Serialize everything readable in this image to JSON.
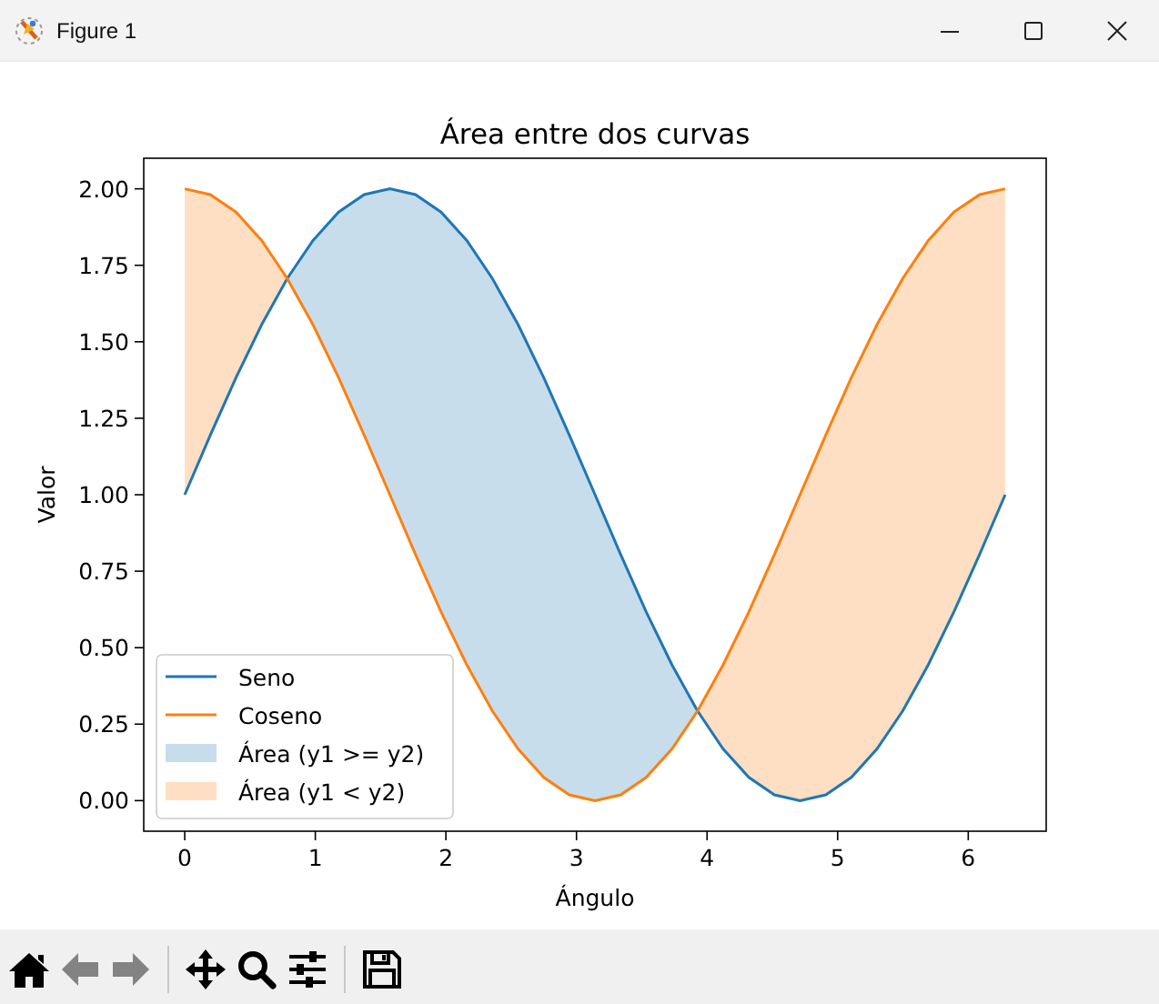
{
  "window": {
    "title": "Figure 1"
  },
  "figure": {
    "chart_data": {
      "type": "line",
      "title": "Área entre dos curvas",
      "xlabel": "Ángulo",
      "ylabel": "Valor",
      "x": [
        0,
        0.196,
        0.393,
        0.589,
        0.785,
        0.982,
        1.178,
        1.374,
        1.571,
        1.767,
        1.963,
        2.16,
        2.356,
        2.553,
        2.749,
        2.945,
        3.142,
        3.338,
        3.534,
        3.731,
        3.927,
        4.123,
        4.32,
        4.516,
        4.712,
        4.909,
        5.105,
        5.301,
        5.498,
        5.694,
        5.89,
        6.087,
        6.283
      ],
      "series": [
        {
          "name": "Seno",
          "type": "line",
          "color": "#1f77b4",
          "values": [
            1,
            1.195,
            1.383,
            1.556,
            1.707,
            1.831,
            1.924,
            1.981,
            2,
            1.981,
            1.924,
            1.831,
            1.707,
            1.556,
            1.383,
            1.195,
            1,
            0.805,
            0.617,
            0.444,
            0.293,
            0.169,
            0.076,
            0.019,
            0,
            0.019,
            0.076,
            0.169,
            0.293,
            0.444,
            0.617,
            0.805,
            1
          ]
        },
        {
          "name": "Coseno",
          "type": "line",
          "color": "#ff7f0e",
          "values": [
            2,
            1.981,
            1.924,
            1.831,
            1.707,
            1.556,
            1.383,
            1.195,
            1,
            0.805,
            0.617,
            0.444,
            0.293,
            0.169,
            0.076,
            0.019,
            0,
            0.019,
            0.076,
            0.169,
            0.293,
            0.444,
            0.617,
            0.805,
            1,
            1.195,
            1.383,
            1.556,
            1.707,
            1.831,
            1.924,
            1.981,
            2
          ]
        },
        {
          "name": "Área (y1 >= y2)",
          "type": "area",
          "color": "#c7ddec",
          "values": [
            null,
            null,
            null,
            null,
            1.707,
            1.831,
            1.924,
            1.981,
            2,
            1.981,
            1.924,
            1.831,
            1.707,
            1.556,
            1.383,
            1.195,
            1,
            0.805,
            0.617,
            0.444,
            0.293,
            null,
            null,
            null,
            null,
            null,
            null,
            null,
            null,
            null,
            null,
            null,
            null
          ]
        },
        {
          "name": "Área (y1 < y2)",
          "type": "area",
          "color": "#ffdfc3",
          "values": [
            2,
            1.981,
            1.924,
            1.831,
            1.707,
            null,
            null,
            null,
            null,
            null,
            null,
            null,
            null,
            null,
            null,
            null,
            null,
            null,
            null,
            null,
            0.293,
            0.444,
            0.617,
            0.805,
            1,
            1.195,
            1.383,
            1.556,
            1.707,
            1.831,
            1.924,
            1.981,
            2
          ]
        }
      ],
      "legend": true,
      "xlim": [
        -0.314,
        6.597
      ],
      "ylim": [
        -0.1,
        2.1
      ],
      "xticks": [
        0,
        1,
        2,
        3,
        4,
        5,
        6
      ],
      "yticks": [
        {
          "value": 0,
          "label": "0.00"
        },
        {
          "value": 0.25,
          "label": "0.25"
        },
        {
          "value": 0.5,
          "label": "0.50"
        },
        {
          "value": 0.75,
          "label": "0.75"
        },
        {
          "value": 1,
          "label": "1.00"
        },
        {
          "value": 1.25,
          "label": "1.25"
        },
        {
          "value": 1.5,
          "label": "1.50"
        },
        {
          "value": 1.75,
          "label": "1.75"
        },
        {
          "value": 2,
          "label": "2.00"
        }
      ]
    }
  },
  "toolbar": {
    "groups": [
      [
        {
          "kind": "home",
          "disabled": false
        },
        {
          "kind": "back",
          "disabled": true
        },
        {
          "kind": "forward",
          "disabled": true
        }
      ],
      [
        {
          "kind": "pan",
          "disabled": false
        },
        {
          "kind": "zoom",
          "disabled": false
        },
        {
          "kind": "configure",
          "disabled": false
        }
      ],
      [
        {
          "kind": "save",
          "disabled": false
        }
      ]
    ]
  }
}
